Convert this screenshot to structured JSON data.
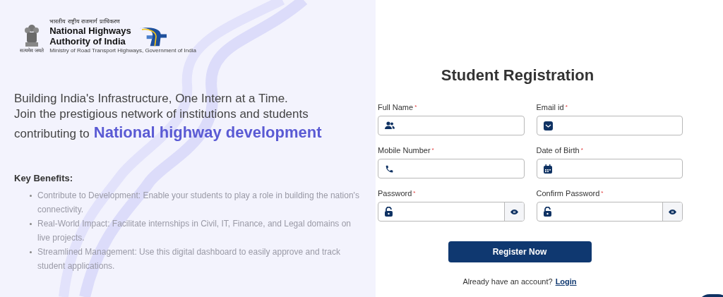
{
  "brand": {
    "hindi": "भारतीय राष्ट्रीय राजमार्ग प्राधिकरण",
    "name_line_1": "National Highways",
    "name_line_2": "Authority of India",
    "ministry": "Ministry of Road Transport Highways, Government of India",
    "emblem_caption": "सत्यमेव जयते"
  },
  "hero": {
    "line_1": "Building India's Infrastructure, One Intern at a Time.",
    "line_2": "Join the prestigious network of institutions and students",
    "line_3_lead": "contributing to",
    "highlight": "National highway development"
  },
  "benefits": {
    "heading": "Key Benefits:",
    "items": [
      "Contribute to Development: Enable your students to play a role in building the nation's connectivity.",
      "Real-World Impact: Facilitate internships in Civil, IT, Finance, and Legal domains on live projects.",
      "Streamlined Management: Use this digital dashboard to easily approve and track student applications."
    ]
  },
  "form": {
    "title": "Student Registration",
    "fields": [
      {
        "label": "Full Name",
        "mark": "*",
        "kind": "name"
      },
      {
        "label": "Email id",
        "mark": "*",
        "kind": "email"
      },
      {
        "label": "Mobile Number",
        "mark": "*",
        "kind": "phone"
      },
      {
        "label": "Date of Birth",
        "mark": "*",
        "kind": "date"
      },
      {
        "label": "Password",
        "mark": "*",
        "kind": "password"
      },
      {
        "label": "Confirm Password",
        "mark": "*",
        "kind": "password"
      }
    ],
    "submit": "Register Now",
    "login_prompt": "Already have an account?",
    "login_link": "Login"
  }
}
